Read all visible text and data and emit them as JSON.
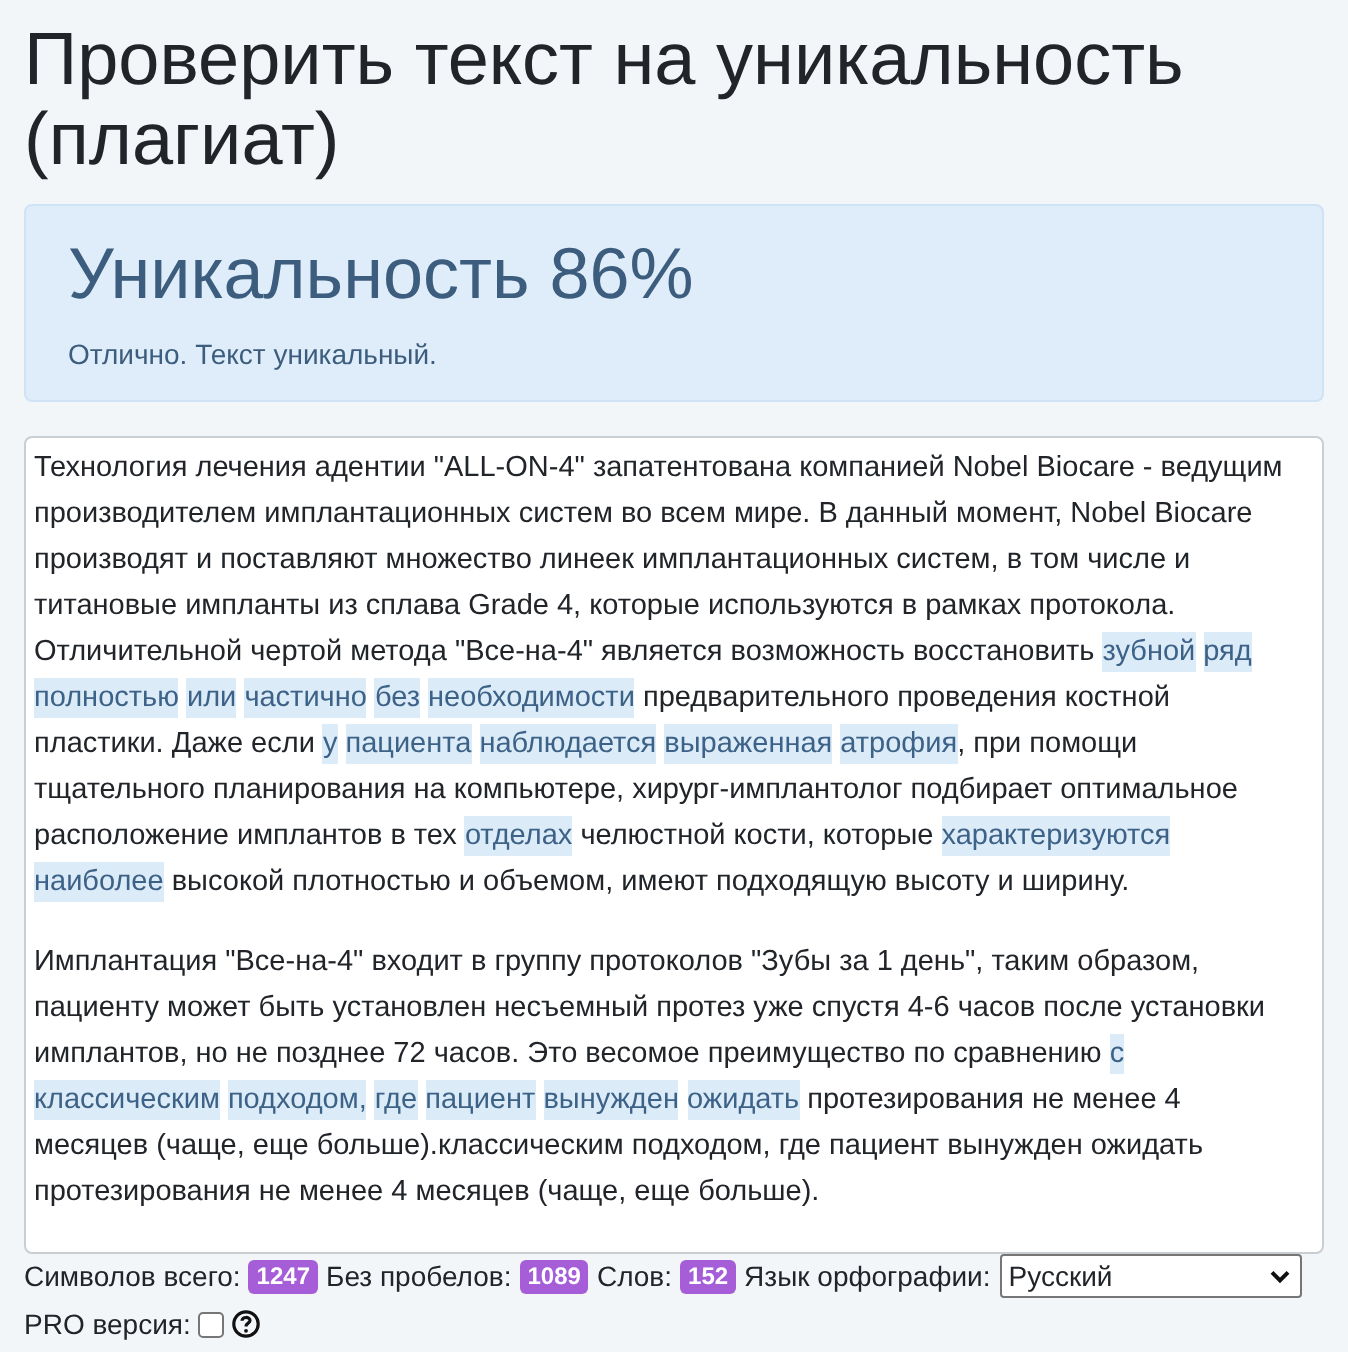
{
  "title": "Проверить текст на уникальность (плагиат)",
  "result": {
    "heading": "Уникальность 86%",
    "message": "Отлично. Текст уникальный."
  },
  "editor": {
    "paragraphs": [
      {
        "segments": [
          {
            "text": "Технология лечения адентии \"ALL-ON-4\" запатентована компанией Nobel Biocare - ведущим производителем имплантационных систем во всем мире. В данный момент, Nobel Biocare производят и поставляют множество линеек имплантационных систем, в том числе и титановые импланты из сплава Grade 4, которые используются в рамках протокола. Отличительной чертой метода \"Все-на-4\" является возможность восстановить ",
            "highlighted": false
          },
          {
            "text": "зубной ряд полностью или частично без необходимости",
            "highlighted": true
          },
          {
            "text": " предварительного проведения костной пластики. Даже если ",
            "highlighted": false
          },
          {
            "text": "у пациента наблюдается выраженная атрофия",
            "highlighted": true
          },
          {
            "text": ", при помощи тщательного планирования на компьютере, хирург-имплантолог подбирает оптимальное расположение имплантов в тех ",
            "highlighted": false
          },
          {
            "text": "отделах",
            "highlighted": true
          },
          {
            "text": " челюстной кости, которые ",
            "highlighted": false
          },
          {
            "text": "характеризуются наиболее",
            "highlighted": true
          },
          {
            "text": " высокой плотностью и объемом, имеют подходящую высоту и ширину.",
            "highlighted": false
          }
        ]
      },
      {
        "segments": [
          {
            "text": "Имплантация \"Все-на-4\" входит в группу протоколов \"Зубы за 1 день\", таким образом, пациенту может быть установлен несъемный протез уже спустя 4-6 часов после установки имплантов, но не позднее 72 часов. Это весомое преимущество по сравнению ",
            "highlighted": false
          },
          {
            "text": "с классическим подходом, где пациент вынужден ожидать",
            "highlighted": true
          },
          {
            "text": " протезирования не менее 4 месяцев (чаще, еще больше).классическим подходом, где пациент вынужден ожидать протезирования не менее 4 месяцев (чаще, еще больше).",
            "highlighted": false
          }
        ]
      }
    ]
  },
  "stats": [
    {
      "label": "Символов всего:",
      "value": "1247"
    },
    {
      "label": "Без пробелов:",
      "value": "1089"
    },
    {
      "label": "Слов:",
      "value": "152"
    }
  ],
  "language": {
    "label": "Язык орфографии:",
    "value": "Русский"
  },
  "pro": {
    "label": "PRO версия:",
    "checked": false
  }
}
